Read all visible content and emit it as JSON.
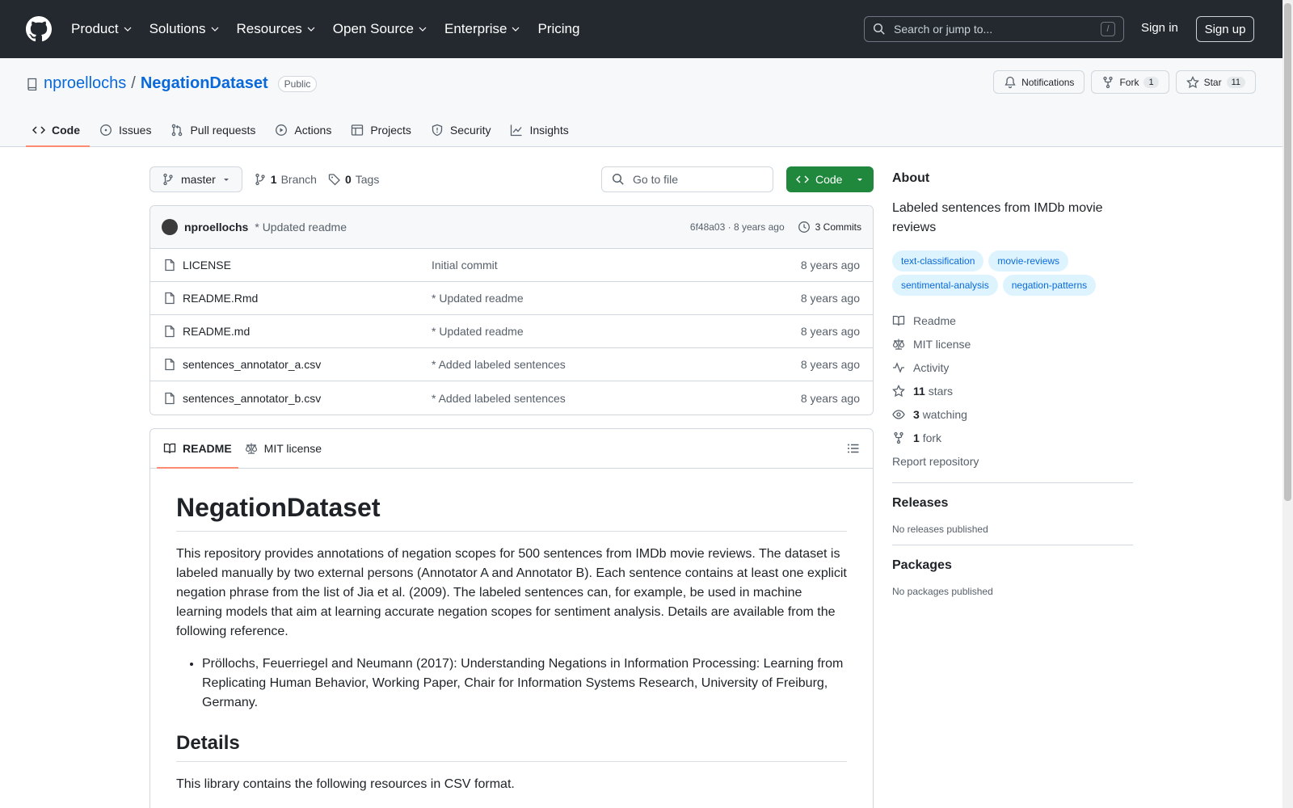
{
  "header": {
    "nav": [
      "Product",
      "Solutions",
      "Resources",
      "Open Source",
      "Enterprise",
      "Pricing"
    ],
    "search_placeholder": "Search or jump to...",
    "search_kbd": "/",
    "signin": "Sign in",
    "signup": "Sign up"
  },
  "repo": {
    "owner": "nproellochs",
    "name": "NegationDataset",
    "visibility": "Public",
    "notifications": "Notifications",
    "fork_label": "Fork",
    "fork_count": "1",
    "star_label": "Star",
    "star_count": "11",
    "tabs": [
      "Code",
      "Issues",
      "Pull requests",
      "Actions",
      "Projects",
      "Security",
      "Insights"
    ]
  },
  "toolbar": {
    "branch": "master",
    "branches_count": "1",
    "branches_label": "Branch",
    "tags_count": "0",
    "tags_label": "Tags",
    "goto_placeholder": "Go to file",
    "code_button": "Code"
  },
  "latest_commit": {
    "author": "nproellochs",
    "message": "* Updated readme",
    "hash_time": "6f48a03 · 8 years ago",
    "commits": "3 Commits"
  },
  "files": [
    {
      "name": "LICENSE",
      "message": "Initial commit",
      "time": "8 years ago"
    },
    {
      "name": "README.Rmd",
      "message": "* Updated readme",
      "time": "8 years ago"
    },
    {
      "name": "README.md",
      "message": "* Updated readme",
      "time": "8 years ago"
    },
    {
      "name": "sentences_annotator_a.csv",
      "message": "* Added labeled sentences",
      "time": "8 years ago"
    },
    {
      "name": "sentences_annotator_b.csv",
      "message": "* Added labeled sentences",
      "time": "8 years ago"
    }
  ],
  "readme": {
    "tab_readme": "README",
    "tab_license": "MIT license",
    "title": "NegationDataset",
    "intro": "This repository provides annotations of negation scopes for 500 sentences from IMDb movie reviews. The dataset is labeled manually by two external persons (Annotator A and Annotator B). Each sentence contains at least one explicit negation phrase from the list of Jia et al. (2009). The labeled sentences can, for example, be used in machine learning models that aim at learning accurate negation scopes for sentiment analysis. Details are available from the following reference.",
    "reference": "Pröllochs, Feuerriegel and Neumann (2017): Understanding Negations in Information Processing: Learning from Replicating Human Behavior, Working Paper, Chair for Information Systems Research, University of Freiburg, Germany.",
    "details_heading": "Details",
    "details_text": "This library contains the following resources in CSV format."
  },
  "about": {
    "heading": "About",
    "description": "Labeled sentences from IMDb movie reviews",
    "topics": [
      "text-classification",
      "movie-reviews",
      "sentimental-analysis",
      "negation-patterns"
    ],
    "readme": "Readme",
    "license": "MIT license",
    "activity": "Activity",
    "stars_count": "11",
    "stars_label": "stars",
    "watching_count": "3",
    "watching_label": "watching",
    "forks_count": "1",
    "forks_label": "fork",
    "report": "Report repository"
  },
  "releases": {
    "heading": "Releases",
    "text": "No releases published"
  },
  "packages": {
    "heading": "Packages",
    "text": "No packages published"
  },
  "colors": {
    "header_bg": "#24292f",
    "accent": "#0969da",
    "green": "#1f883d",
    "tab_underline": "#fd8c73"
  }
}
